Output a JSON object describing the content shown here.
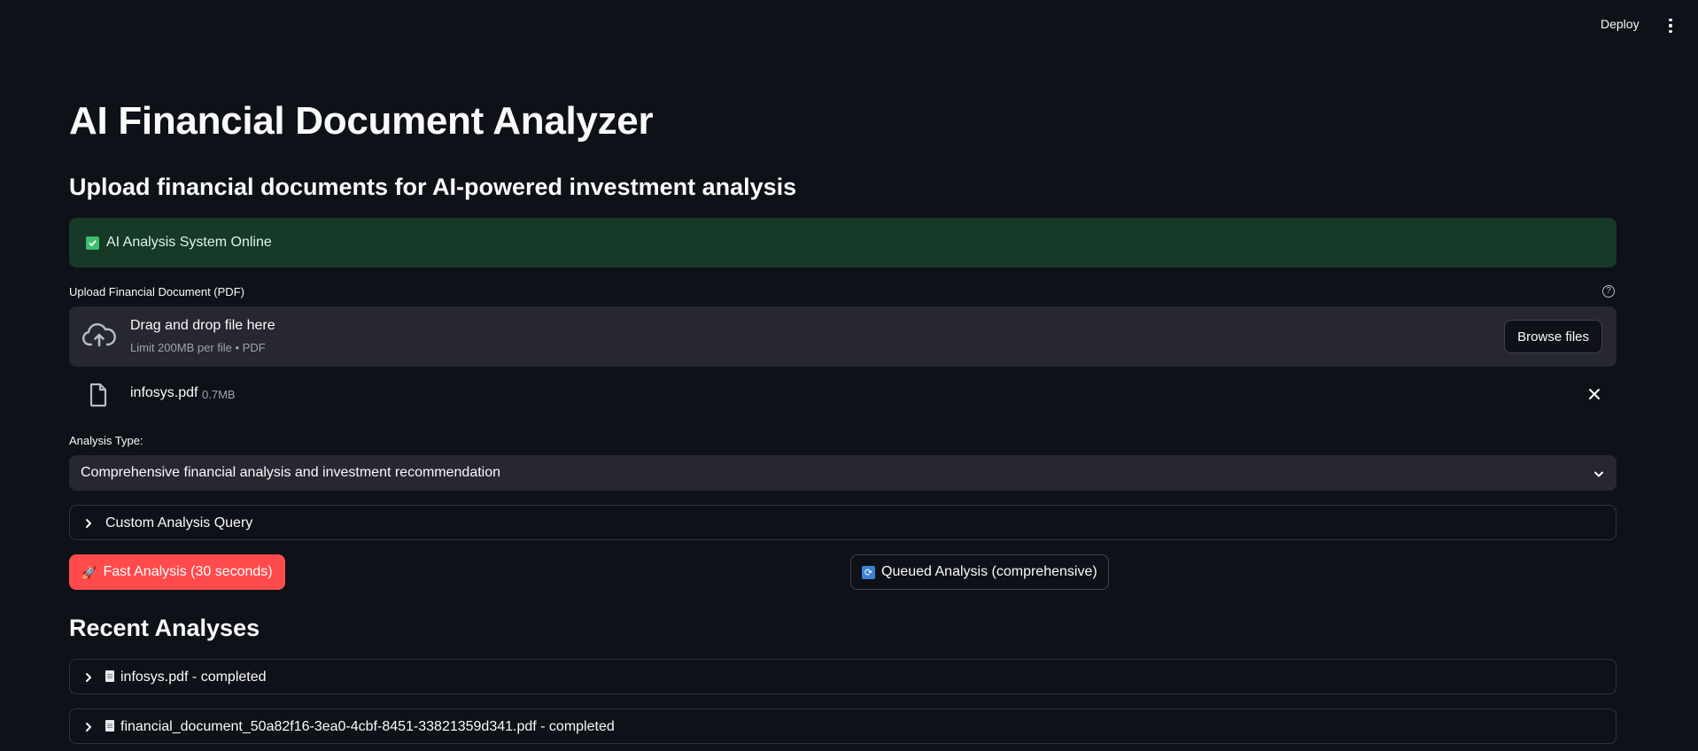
{
  "header": {
    "deploy_label": "Deploy",
    "menu_icon": "more-vertical-icon"
  },
  "page": {
    "title": "AI Financial Document Analyzer",
    "subtitle": "Upload financial documents for AI-powered investment analysis"
  },
  "status": {
    "icon": "check-box-icon",
    "text": "AI Analysis System Online",
    "color": "#173928"
  },
  "uploader": {
    "label": "Upload Financial Document (PDF)",
    "drop_title": "Drag and drop file here",
    "drop_hint": "Limit 200MB per file • PDF",
    "browse_label": "Browse files",
    "file": {
      "name": "infosys.pdf",
      "size": "0.7MB"
    }
  },
  "analysis": {
    "label": "Analysis Type:",
    "selected": "Comprehensive financial analysis and investment recommendation"
  },
  "custom_query": {
    "label": "Custom Analysis Query"
  },
  "buttons": {
    "fast_label": "Fast Analysis (30 seconds)",
    "fast_color": "#ff4b4b",
    "queued_label": "Queued Analysis (comprehensive)"
  },
  "recent": {
    "title": "Recent Analyses",
    "items": [
      {
        "label": "infosys.pdf - completed"
      },
      {
        "label": "financial_document_50a82f16-3ea0-4cbf-8451-33821359d341.pdf - completed"
      }
    ]
  }
}
